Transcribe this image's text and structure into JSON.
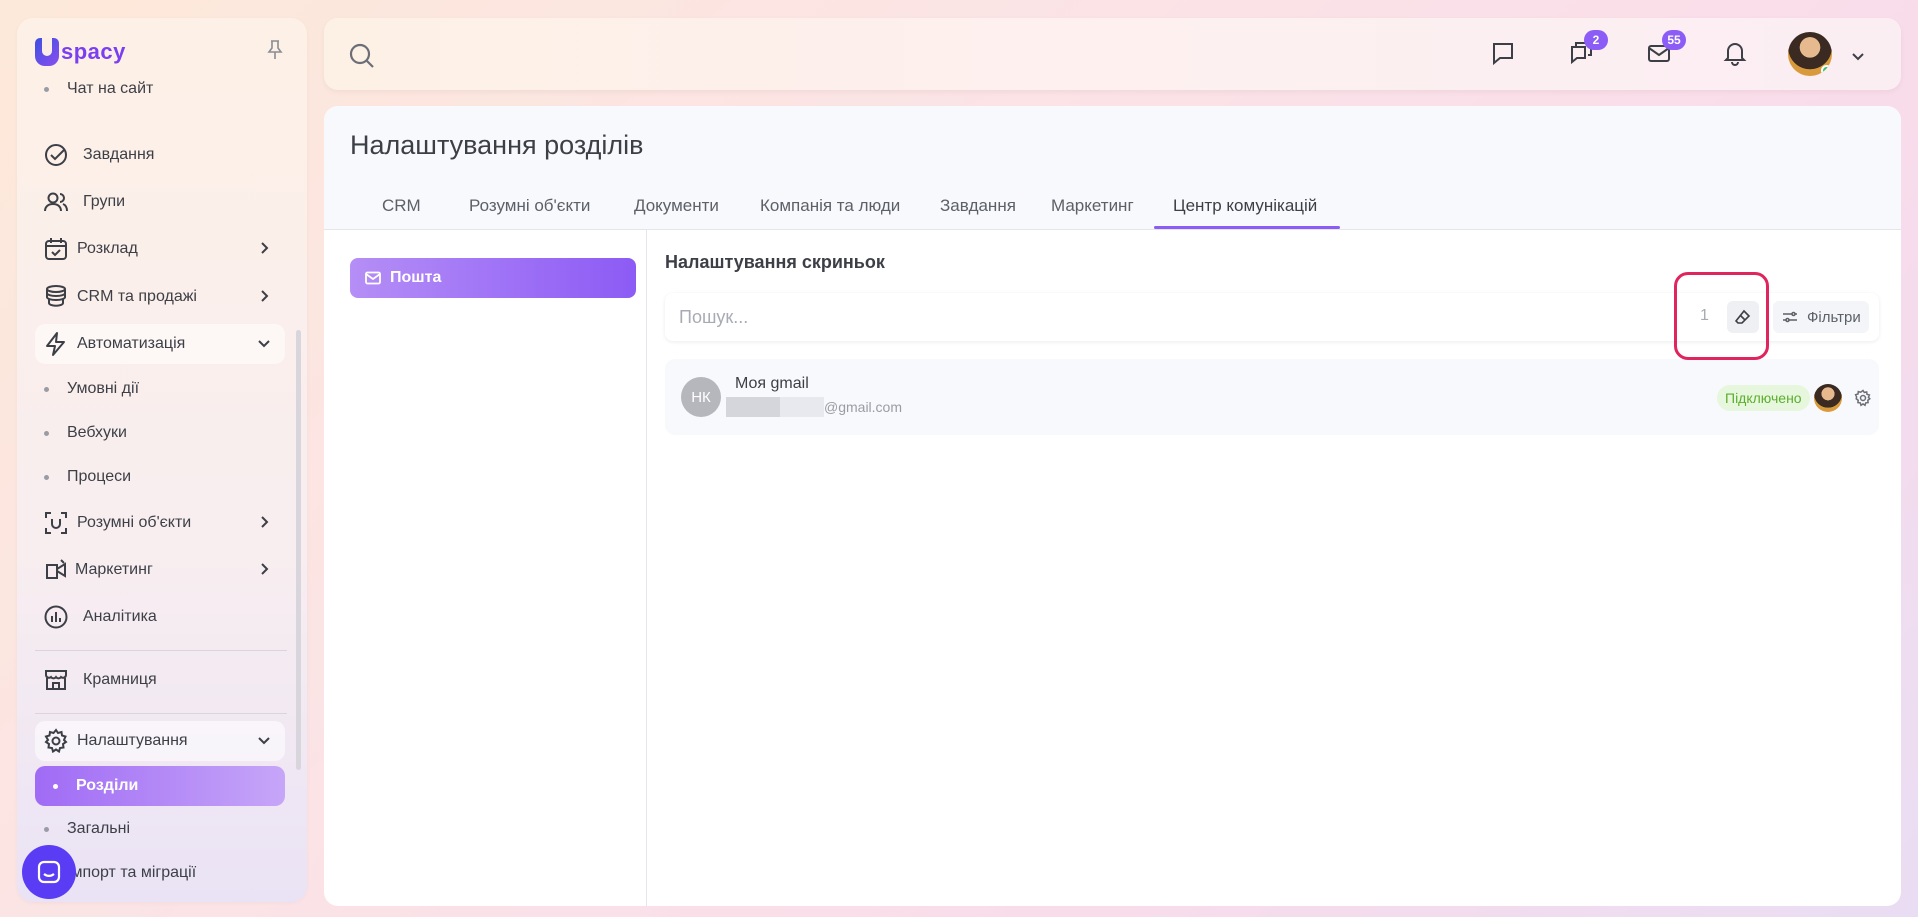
{
  "logo": {
    "text": "spacy"
  },
  "sidebar": {
    "items": [
      {
        "label": "Чат на сайт"
      },
      {
        "label": "Завдання"
      },
      {
        "label": "Групи"
      },
      {
        "label": "Розклад"
      },
      {
        "label": "CRM та продажі"
      },
      {
        "label": "Автоматизація"
      },
      {
        "label": "Умовні дії"
      },
      {
        "label": "Вебхуки"
      },
      {
        "label": "Процеси"
      },
      {
        "label": "Розумні об'єкти"
      },
      {
        "label": "Маркетинг"
      },
      {
        "label": "Аналітика"
      },
      {
        "label": "Крамниця"
      },
      {
        "label": "Налаштування"
      },
      {
        "label": "Розділи"
      },
      {
        "label": "Загальні"
      },
      {
        "label": "Імпорт та міграції"
      }
    ]
  },
  "header": {
    "chat_badge": "2",
    "mail_badge": "55"
  },
  "page": {
    "title": "Налаштування розділів",
    "tabs": [
      {
        "label": "CRM"
      },
      {
        "label": "Розумні об'єкти"
      },
      {
        "label": "Документи"
      },
      {
        "label": "Компанія та люди"
      },
      {
        "label": "Завдання"
      },
      {
        "label": "Маркетинг"
      },
      {
        "label": "Центр комунікацій"
      }
    ],
    "active_tab": "Центр комунікацій",
    "left_menu": {
      "mail_label": "Пошта"
    },
    "section_title": "Налаштування скриньок",
    "search": {
      "placeholder": "Пошук...",
      "count": "1"
    },
    "filters_label": "Фільтри",
    "mailboxes": [
      {
        "initials": "НК",
        "name": "Моя gmail",
        "email_domain": "@gmail.com",
        "status": "Підключено"
      }
    ]
  },
  "colors": {
    "accent": "#8b5cf6",
    "highlight": "#e0245e",
    "status_green": "#5cae2e"
  }
}
